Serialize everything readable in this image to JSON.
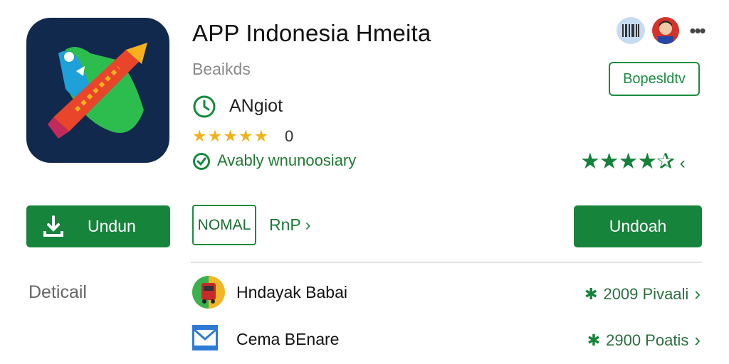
{
  "app": {
    "title": "APP Indonesia Hmeita",
    "subtitle": "Beaikds",
    "category": "ANgiot",
    "rating_stars": "★★★★★",
    "rating_count": "0",
    "verified_text": "Avably wnunoosiary",
    "large_rating_stars": "★★★★✰",
    "large_rating_suffix": "‹"
  },
  "header": {
    "more_glyph": "•••"
  },
  "buttons": {
    "outline_label": "Bopesldtv",
    "primary_left_label": "Undun",
    "nomal_label": "NOMAL",
    "rnp_label": "RnP ›",
    "primary_right_label": "Undoah"
  },
  "details": {
    "label": "Deticail",
    "rows": [
      {
        "label": "Hndayak Babai",
        "meta": "2009 Pivaali",
        "icon": "bus-icon"
      },
      {
        "label": "Cema BEnare",
        "meta": "2900 Poatis",
        "icon": "mail-icon"
      }
    ],
    "meta_glyph": "✱",
    "chevron": "›"
  },
  "colors": {
    "accent_green": "#16843b",
    "star_gold": "#f3b21c",
    "icon_bg": "#12294e"
  }
}
